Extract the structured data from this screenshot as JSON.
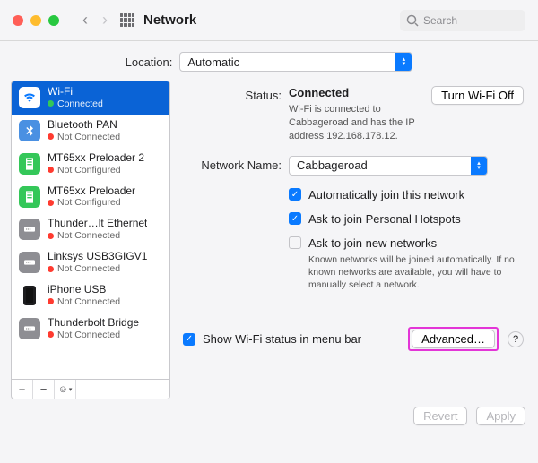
{
  "titlebar": {
    "title": "Network",
    "search_placeholder": "Search"
  },
  "location": {
    "label": "Location:",
    "value": "Automatic"
  },
  "sidebar": {
    "items": [
      {
        "name": "Wi-Fi",
        "status": "Connected",
        "dot": "green",
        "selected": true
      },
      {
        "name": "Bluetooth PAN",
        "status": "Not Connected",
        "dot": "red"
      },
      {
        "name": "MT65xx Preloader 2",
        "status": "Not Configured",
        "dot": "red"
      },
      {
        "name": "MT65xx Preloader",
        "status": "Not Configured",
        "dot": "red"
      },
      {
        "name": "Thunder…lt Ethernet",
        "status": "Not Connected",
        "dot": "red"
      },
      {
        "name": "Linksys USB3GIGV1",
        "status": "Not Connected",
        "dot": "red"
      },
      {
        "name": "iPhone USB",
        "status": "Not Connected",
        "dot": "red"
      },
      {
        "name": "Thunderbolt Bridge",
        "status": "Not Connected",
        "dot": "red"
      }
    ]
  },
  "main": {
    "status_label": "Status:",
    "status_value": "Connected",
    "turn_off_btn": "Turn Wi-Fi Off",
    "status_desc": "Wi-Fi is connected to Cabbageroad and has the IP address 192.168.178.12.",
    "network_label": "Network Name:",
    "network_value": "Cabbageroad",
    "opt_auto_join": "Automatically join this network",
    "opt_ask_hotspots": "Ask to join Personal Hotspots",
    "opt_ask_new": "Ask to join new networks",
    "opt_new_desc": "Known networks will be joined automatically. If no known networks are available, you will have to manually select a network.",
    "show_status": "Show Wi-Fi status in menu bar",
    "advanced_btn": "Advanced…",
    "help": "?"
  },
  "footer": {
    "revert": "Revert",
    "apply": "Apply"
  }
}
